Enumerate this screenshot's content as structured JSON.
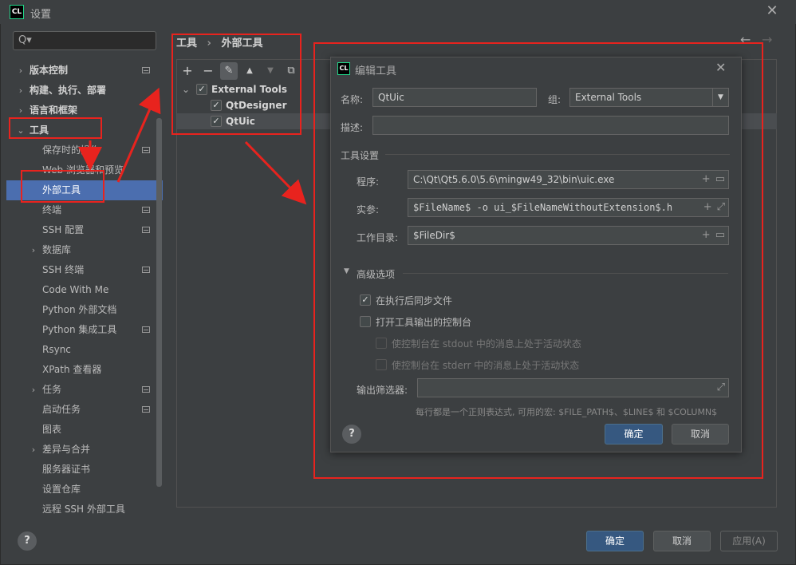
{
  "window": {
    "title": "设置",
    "app_logo": "CL"
  },
  "search": {
    "placeholder": "Q▾"
  },
  "sidebar": {
    "items": [
      {
        "label": "版本控制",
        "arrow": "›",
        "bold": true,
        "badge": true
      },
      {
        "label": "构建、执行、部署",
        "arrow": "›",
        "bold": true,
        "badge": false
      },
      {
        "label": "语言和框架",
        "arrow": "›",
        "bold": true,
        "badge": false
      },
      {
        "label": "工具",
        "arrow": "⌄",
        "bold": true,
        "badge": false
      },
      {
        "label": "保存时的操作",
        "arrow": "",
        "bold": false,
        "badge": true
      },
      {
        "label": "Web 浏览器和预览",
        "arrow": "",
        "bold": false,
        "badge": false
      },
      {
        "label": "外部工具",
        "arrow": "",
        "bold": false,
        "badge": false,
        "selected": true
      },
      {
        "label": "终端",
        "arrow": "",
        "bold": false,
        "badge": true
      },
      {
        "label": "SSH 配置",
        "arrow": "",
        "bold": false,
        "badge": true
      },
      {
        "label": "数据库",
        "arrow": "›",
        "bold": false,
        "badge": false
      },
      {
        "label": "SSH 终端",
        "arrow": "",
        "bold": false,
        "badge": true
      },
      {
        "label": "Code With Me",
        "arrow": "",
        "bold": false,
        "badge": false
      },
      {
        "label": "Python 外部文档",
        "arrow": "",
        "bold": false,
        "badge": false
      },
      {
        "label": "Python 集成工具",
        "arrow": "",
        "bold": false,
        "badge": true
      },
      {
        "label": "Rsync",
        "arrow": "",
        "bold": false,
        "badge": false
      },
      {
        "label": "XPath 查看器",
        "arrow": "",
        "bold": false,
        "badge": false
      },
      {
        "label": "任务",
        "arrow": "›",
        "bold": false,
        "badge": true
      },
      {
        "label": "启动任务",
        "arrow": "",
        "bold": false,
        "badge": true
      },
      {
        "label": "图表",
        "arrow": "",
        "bold": false,
        "badge": false
      },
      {
        "label": "差异与合并",
        "arrow": "›",
        "bold": false,
        "badge": false
      },
      {
        "label": "服务器证书",
        "arrow": "",
        "bold": false,
        "badge": false
      },
      {
        "label": "设置仓库",
        "arrow": "",
        "bold": false,
        "badge": false
      },
      {
        "label": "远程 SSH 外部工具",
        "arrow": "",
        "bold": false,
        "badge": false
      }
    ]
  },
  "breadcrumb": {
    "parent": "工具",
    "separator": "›",
    "current": "外部工具"
  },
  "nav": {
    "back": "←",
    "forward": "→"
  },
  "toolbar": {
    "add": "+",
    "remove": "−",
    "edit": "✎",
    "up": "▲",
    "down": "▼",
    "copy": "⧉"
  },
  "tools_tree": {
    "group": "External Tools",
    "group_arrow": "⌄",
    "items": [
      {
        "label": "QtDesigner",
        "checked": true
      },
      {
        "label": "QtUic",
        "checked": true
      }
    ],
    "check": "✓"
  },
  "dialog": {
    "title": "编辑工具",
    "logo": "CL",
    "close": "✕",
    "name_label": "名称:",
    "name_value": "QtUic",
    "group_label": "组:",
    "group_value": "External Tools",
    "desc_label": "描述:",
    "desc_value": "",
    "tool_settings_label": "工具设置",
    "program_label": "程序:",
    "program_value": "C:\\Qt\\Qt5.6.0\\5.6\\mingw49_32\\bin\\uic.exe",
    "args_label": "实参:",
    "args_value": "$FileName$ -o ui_$FileNameWithoutExtension$.h",
    "workdir_label": "工作目录:",
    "workdir_value": "$FileDir$",
    "advanced_label": "高级选项",
    "sync_files_label": "在执行后同步文件",
    "sync_files_checked": true,
    "open_console_label": "打开工具输出的控制台",
    "open_console_checked": false,
    "stdout_label": "使控制台在 stdout 中的消息上处于活动状态",
    "stderr_label": "使控制台在 stderr 中的消息上处于活动状态",
    "output_filter_label": "输出筛选器:",
    "output_filter_value": "",
    "hint": "每行都是一个正则表达式, 可用的宏: $FILE_PATH$、$LINE$ 和 $COLUMN$",
    "ok": "确定",
    "cancel": "取消"
  },
  "footer": {
    "ok": "确定",
    "cancel": "取消",
    "apply": "应用(A)"
  },
  "help": "?",
  "colors": {
    "accent": "#4b6eaf",
    "annotation": "#e8231e",
    "primary_button": "#365880"
  }
}
